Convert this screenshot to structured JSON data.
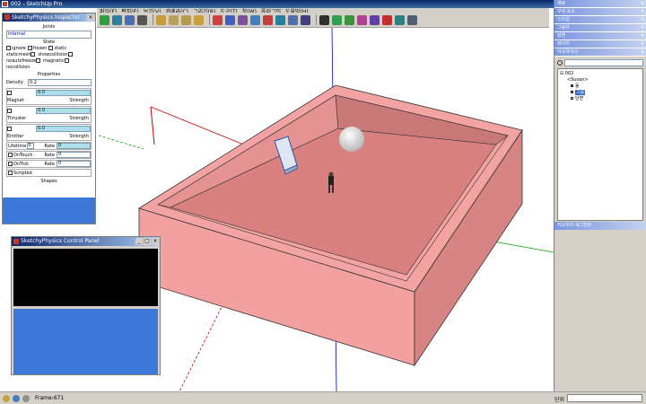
{
  "window": {
    "title": "002 - SketchUp Pro",
    "minimize_glyph": "_",
    "maximize_glyph": "□",
    "close_glyph": "×"
  },
  "menubar": {
    "items": [
      "파일(F)",
      "편집(E)",
      "보기(V)",
      "카메라(C)",
      "그리기(R)",
      "도구(T)",
      "창(W)",
      "플러그인",
      "도움말(H)"
    ]
  },
  "toolbar": {
    "icons": [
      {
        "name": "play-icon",
        "color": "#2e9e3e"
      },
      {
        "name": "pause-icon",
        "color": "#2e7ea0"
      },
      {
        "name": "reset-icon",
        "color": "#4a6fb0"
      },
      {
        "name": "record-icon",
        "color": "#555555"
      },
      {
        "name": "cube-icon",
        "color": "#c89b3c"
      },
      {
        "name": "box-icon",
        "color": "#b8a060"
      },
      {
        "name": "cylinder-icon",
        "color": "#b89a50"
      },
      {
        "name": "cone-icon",
        "color": "#c8a040"
      },
      {
        "name": "magnet-icon",
        "color": "#d04040"
      },
      {
        "name": "hinge-icon",
        "color": "#4060c0"
      },
      {
        "name": "joint-icon",
        "color": "#8050a0"
      },
      {
        "name": "servo-icon",
        "color": "#4080c0"
      },
      {
        "name": "spring-icon",
        "color": "#c04040"
      },
      {
        "name": "slider-icon",
        "color": "#2080a0"
      },
      {
        "name": "piston-icon",
        "color": "#5070b0"
      },
      {
        "name": "corner-icon",
        "color": "#404080"
      },
      {
        "name": "sphere-icon",
        "color": "#303030"
      },
      {
        "name": "gear-icon",
        "color": "#30a050"
      },
      {
        "name": "lever-icon",
        "color": "#409040"
      },
      {
        "name": "wand-icon",
        "color": "#b04090"
      },
      {
        "name": "pin-icon",
        "color": "#6040a0"
      },
      {
        "name": "target-icon",
        "color": "#c03030"
      },
      {
        "name": "scissors-icon",
        "color": "#308080"
      },
      {
        "name": "wrench-icon",
        "color": "#506070"
      }
    ]
  },
  "physics_panel": {
    "title": "SketchyPhysics Inspector",
    "close_glyph": "×",
    "joints_header": "Joints",
    "joints_value": "internal",
    "state_header": "State",
    "state_options": [
      "ignore",
      "frozen",
      "static",
      "staticmesh",
      "showcollision",
      "noautofreeze",
      "magnetic",
      "nocollision"
    ],
    "properties_header": "Properties",
    "density_label": "Density",
    "density_value": "0.2",
    "magnet": {
      "label": "Magnet",
      "strength_label": "Strength",
      "value": "0.0"
    },
    "thruster": {
      "label": "Thruster",
      "strength_label": "Strength",
      "value": "0.0"
    },
    "emitter": {
      "label": "Emitter",
      "strength_label": "Strength",
      "value": "0.0"
    },
    "lifetime": {
      "label": "Lifetime",
      "value": "0",
      "rate_label": "Rate",
      "rate_value": "0"
    },
    "ontouch": {
      "label": "OnTouch",
      "rate_label": "Rate",
      "rate_value": "0"
    },
    "ontick": {
      "label": "OnTick",
      "rate_label": "Rate",
      "rate_value": "0"
    },
    "scripted_label": "Scripted",
    "shapes_header": "Shapes"
  },
  "control_panel": {
    "title": "SketchyPhysics Control Panel",
    "minimize_glyph": "_",
    "maximize_glyph": "□",
    "close_glyph": "×"
  },
  "right_panel": {
    "headers": [
      "재료",
      "구성 요소",
      "스타일",
      "그림자",
      "장면",
      "레이어",
      "아웃라이너"
    ],
    "outliner": {
      "root": "002",
      "items": [
        {
          "label": "<Susan>",
          "selected": false
        },
        {
          "label": "동",
          "selected": false
        },
        {
          "label": "그룹",
          "selected": true
        },
        {
          "label": "단면",
          "selected": false
        }
      ]
    },
    "footer": "지오위치 세그먼트"
  },
  "statusbar": {
    "frame_text": "Frame:671",
    "unit_label": "단위"
  },
  "colors": {
    "box_top": "#f4a3a3",
    "box_inner_floor": "#d98181",
    "box_inner_wall": "#e49292",
    "box_front": "#f2a0a0",
    "box_right": "#d78484",
    "axis_red": "#cc0000",
    "axis_green": "#00aa00",
    "axis_blue": "#0000cc",
    "panel_blue": "#3c78d8"
  }
}
